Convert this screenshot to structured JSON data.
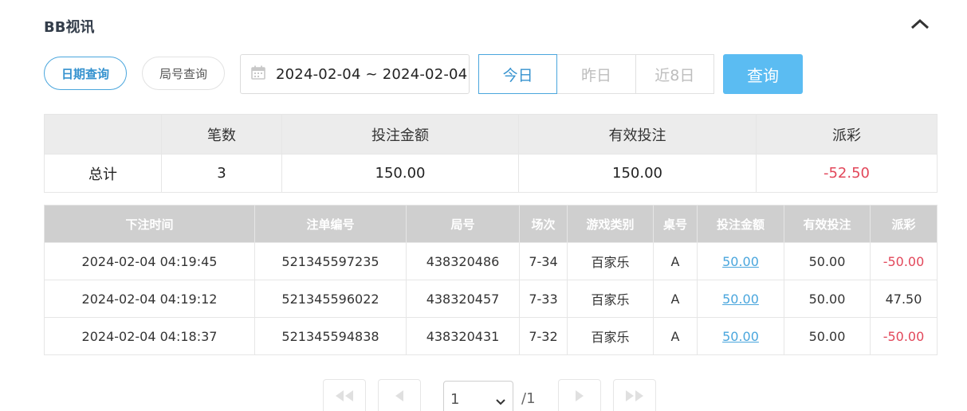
{
  "header": {
    "title": "BB视讯"
  },
  "filters": {
    "mode_buttons": [
      "日期查询",
      "局号查询"
    ],
    "date_range": "2024-02-04 ~ 2024-02-04",
    "quick_ranges": [
      "今日",
      "昨日",
      "近8日"
    ],
    "query_label": "查询"
  },
  "summary": {
    "headers": [
      "",
      "笔数",
      "投注金额",
      "有效投注",
      "派彩"
    ],
    "row": [
      "总计",
      "3",
      "150.00",
      "150.00",
      "-52.50"
    ]
  },
  "detail": {
    "headers": [
      "下注时间",
      "注单编号",
      "局号",
      "场次",
      "游戏类别",
      "桌号",
      "投注金额",
      "有效投注",
      "派彩"
    ],
    "rows": [
      [
        "2024-02-04 04:19:45",
        "521345597235",
        "438320486",
        "7-34",
        "百家乐",
        "A",
        "50.00",
        "50.00",
        "-50.00"
      ],
      [
        "2024-02-04 04:19:12",
        "521345596022",
        "438320457",
        "7-33",
        "百家乐",
        "A",
        "50.00",
        "50.00",
        "47.50"
      ],
      [
        "2024-02-04 04:18:37",
        "521345594838",
        "438320431",
        "7-32",
        "百家乐",
        "A",
        "50.00",
        "50.00",
        "-50.00"
      ]
    ]
  },
  "pagination": {
    "current": "1",
    "total": "/1"
  },
  "colors": {
    "accent": "#5bbcf2",
    "negative": "#e2475a",
    "link": "#4aa6dd"
  }
}
